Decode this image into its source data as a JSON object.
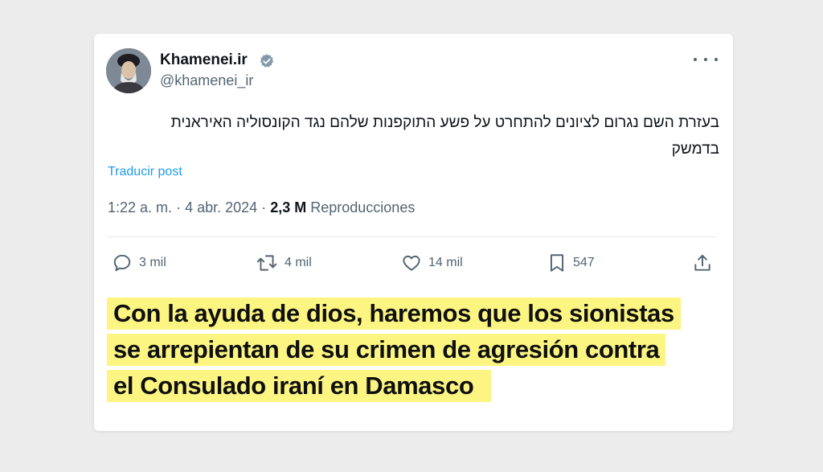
{
  "tweet": {
    "display_name": "Khamenei.ir",
    "handle": "@khamenei_ir",
    "text_line1": "בעזרת השם נגרום לציונים להתחרט על פשע התוקפנות שלהם נגד הקונסוליה האיראנית",
    "text_line2": "בדמשק",
    "translate_label": "Traducir post",
    "time": "1:22 a. m.",
    "date": "4 abr. 2024",
    "views_count": "2,3 M",
    "views_label": "Reproducciones",
    "separator": "·",
    "replies": "3 mil",
    "reposts": "4 mil",
    "likes": "14 mil",
    "bookmarks": "547"
  },
  "icons": {
    "verified": "verified-badge-icon",
    "more": "more-options-icon",
    "reply": "reply-icon",
    "repost": "repost-icon",
    "like": "heart-icon",
    "bookmark": "bookmark-icon",
    "share": "share-icon"
  },
  "colors": {
    "link": "#1d9bf0",
    "highlight": "#fcf582",
    "muted": "#536471",
    "text": "#0f1419"
  },
  "translation_caption": {
    "line1": "Con la ayuda de dios, haremos que los sionistas",
    "line2": "se arrepientan de su crimen de agresión contra",
    "line3": "el Consulado iraní en Damasco"
  }
}
